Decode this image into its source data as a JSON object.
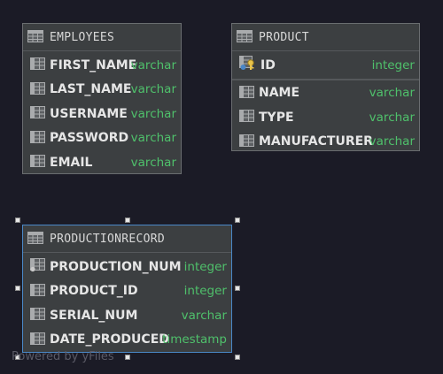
{
  "tables": [
    {
      "name": "EMPLOYEES",
      "columns": [
        {
          "name": "FIRST_NAME",
          "type": "varchar",
          "icon": "column-icon"
        },
        {
          "name": "LAST_NAME",
          "type": "varchar",
          "icon": "column-icon"
        },
        {
          "name": "USERNAME",
          "type": "varchar",
          "icon": "column-icon"
        },
        {
          "name": "PASSWORD",
          "type": "varchar",
          "icon": "column-icon"
        },
        {
          "name": "EMAIL",
          "type": "varchar",
          "icon": "column-icon"
        }
      ]
    },
    {
      "name": "PRODUCT",
      "key_columns": [
        {
          "name": "ID",
          "type": "integer",
          "icon": "primary-key-icon"
        }
      ],
      "columns": [
        {
          "name": "NAME",
          "type": "varchar",
          "icon": "column-icon"
        },
        {
          "name": "TYPE",
          "type": "varchar",
          "icon": "column-icon"
        },
        {
          "name": "MANUFACTURER",
          "type": "varchar",
          "icon": "column-icon"
        }
      ]
    },
    {
      "name": "PRODUCTIONRECORD",
      "selected": true,
      "columns": [
        {
          "name": "PRODUCTION_NUM",
          "type": "integer",
          "icon": "column-icon"
        },
        {
          "name": "PRODUCT_ID",
          "type": "integer",
          "icon": "column-icon"
        },
        {
          "name": "SERIAL_NUM",
          "type": "varchar",
          "icon": "column-icon"
        },
        {
          "name": "DATE_PRODUCED",
          "type": "timestamp",
          "icon": "column-icon"
        }
      ]
    }
  ],
  "watermark": "Powered by yFiles",
  "colors": {
    "background": "#1b1b26",
    "table_fill": "#3c3f41",
    "type_text": "#4fc06b",
    "selection_border": "#4a88c7"
  }
}
